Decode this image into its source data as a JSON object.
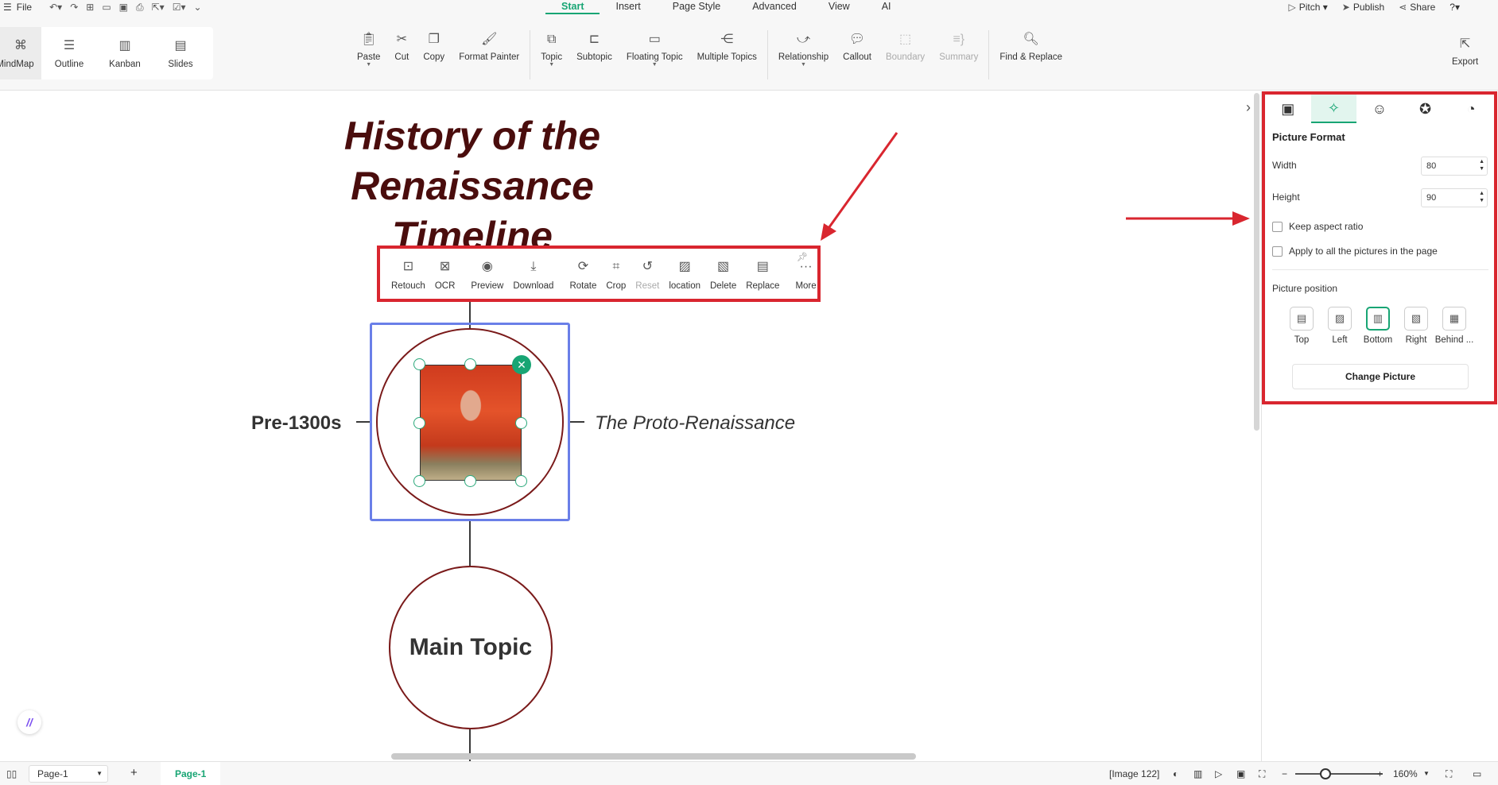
{
  "menubar": {
    "file": "File",
    "tabs": [
      "Start",
      "Insert",
      "Page Style",
      "Advanced",
      "View",
      "AI"
    ],
    "active_tab": "Start",
    "right": {
      "pitch": "Pitch",
      "publish": "Publish",
      "share": "Share"
    }
  },
  "views": [
    {
      "label": "MindMap",
      "icon": "mindmap-icon"
    },
    {
      "label": "Outline",
      "icon": "outline-icon"
    },
    {
      "label": "Kanban",
      "icon": "kanban-icon"
    },
    {
      "label": "Slides",
      "icon": "slides-icon"
    }
  ],
  "tools": {
    "paste": "Paste",
    "cut": "Cut",
    "copy": "Copy",
    "format_painter": "Format Painter",
    "topic": "Topic",
    "subtopic": "Subtopic",
    "floating_topic": "Floating Topic",
    "multiple_topics": "Multiple Topics",
    "relationship": "Relationship",
    "callout": "Callout",
    "boundary": "Boundary",
    "summary": "Summary",
    "find_replace": "Find & Replace",
    "export": "Export"
  },
  "canvas": {
    "title": "History of the Renaissance Timeline",
    "left_label": "Pre-1300s",
    "right_label": "The Proto-Renaissance",
    "main_topic": "Main Topic"
  },
  "picture_toolbar": {
    "items": [
      "Retouch",
      "OCR",
      "Preview",
      "Download",
      "Rotate",
      "Crop",
      "Reset",
      "location",
      "Delete",
      "Replace",
      "More"
    ]
  },
  "panel": {
    "title": "Picture Format",
    "width_label": "Width",
    "width_value": "80",
    "height_label": "Height",
    "height_value": "90",
    "keep_aspect": "Keep aspect ratio",
    "apply_all": "Apply to all the pictures in the page",
    "position_label": "Picture position",
    "positions": [
      "Top",
      "Left",
      "Bottom",
      "Right",
      "Behind ..."
    ],
    "active_position": "Bottom",
    "change_picture": "Change Picture"
  },
  "statusbar": {
    "page_select": "Page-1",
    "page_tab": "Page-1",
    "image_info": "[Image 122]",
    "zoom": "160%"
  },
  "colors": {
    "accent": "#18a574",
    "highlight": "#d9262f",
    "title": "#4a0d0d",
    "selection": "#6a7fe8"
  }
}
